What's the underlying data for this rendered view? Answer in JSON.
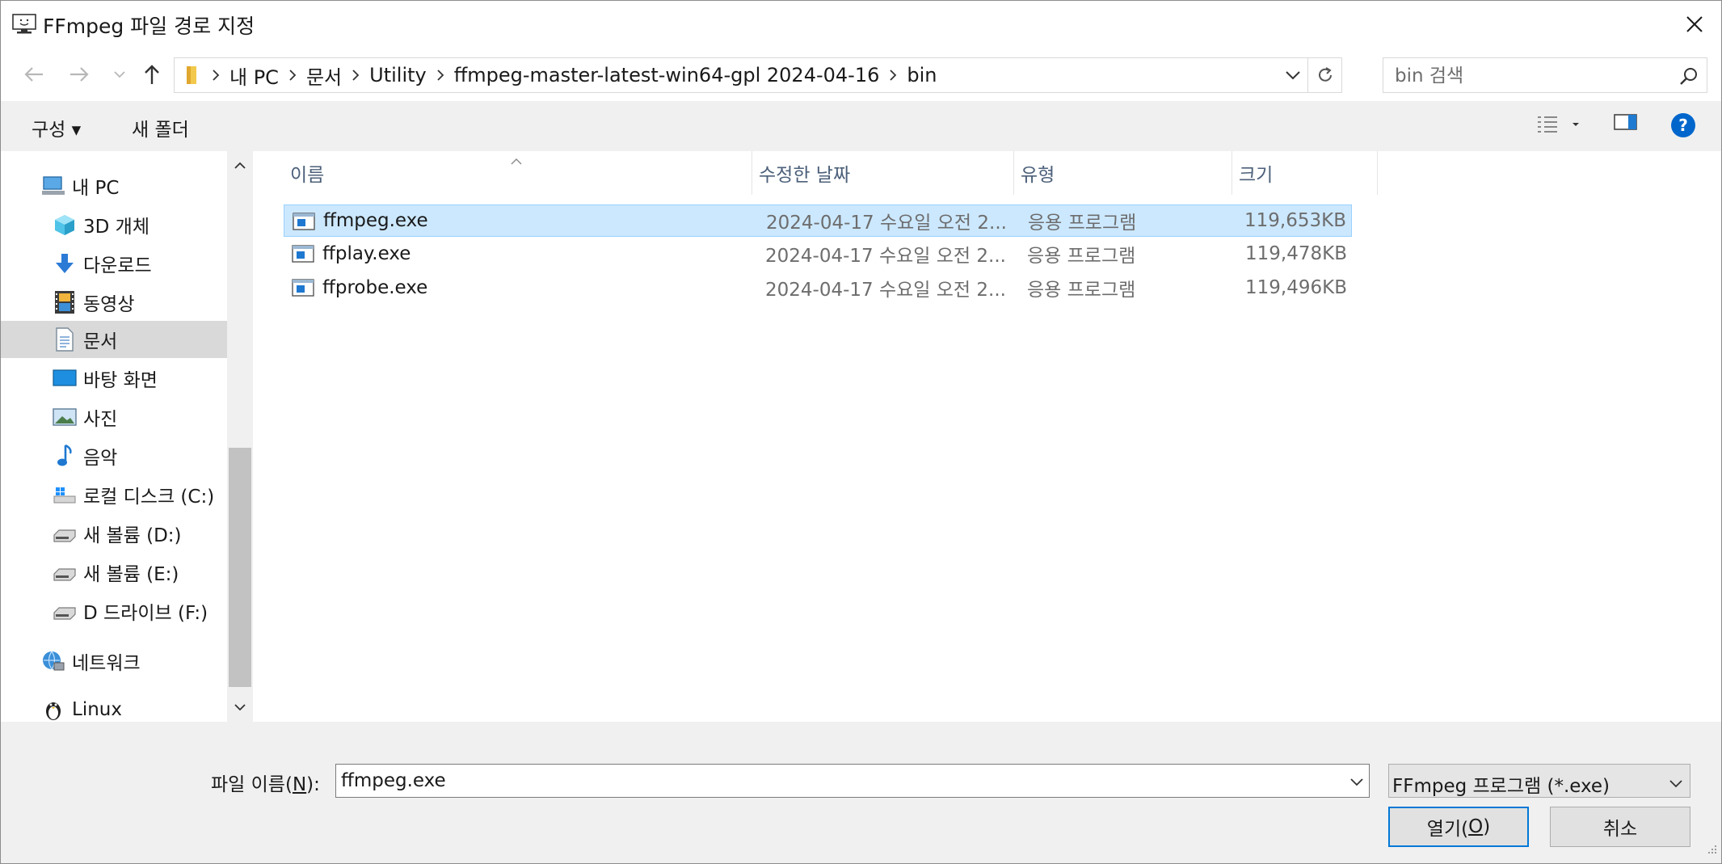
{
  "window": {
    "title": "FFmpeg 파일 경로 지정"
  },
  "address": {
    "crumbs": [
      "내 PC",
      "문서",
      "Utility",
      "ffmpeg-master-latest-win64-gpl 2024-04-16",
      "bin"
    ],
    "search_placeholder": "bin 검색"
  },
  "toolbar": {
    "organize_label": "구성 ▾",
    "new_folder_label": "새 폴더"
  },
  "nav": {
    "items": [
      {
        "label": "내 PC",
        "icon": "computer-icon"
      },
      {
        "label": "3D 개체",
        "icon": "cube-icon"
      },
      {
        "label": "다운로드",
        "icon": "download-arrow-icon"
      },
      {
        "label": "동영상",
        "icon": "film-icon"
      },
      {
        "label": "문서",
        "icon": "document-icon"
      },
      {
        "label": "바탕 화면",
        "icon": "desktop-icon"
      },
      {
        "label": "사진",
        "icon": "picture-icon"
      },
      {
        "label": "음악",
        "icon": "music-note-icon"
      },
      {
        "label": "로컬 디스크 (C:)",
        "icon": "windows-drive-icon"
      },
      {
        "label": "새 볼륨 (D:)",
        "icon": "drive-icon"
      },
      {
        "label": "새 볼륨 (E:)",
        "icon": "drive-icon"
      },
      {
        "label": "D 드라이브 (F:)",
        "icon": "drive-icon"
      },
      {
        "label": "네트워크",
        "icon": "network-icon"
      },
      {
        "label": "Linux",
        "icon": "penguin-icon"
      }
    ],
    "selected_index": 4
  },
  "columns": {
    "name": "이름",
    "modified": "수정한 날짜",
    "type": "유형",
    "size": "크기"
  },
  "files": [
    {
      "name": "ffmpeg.exe",
      "modified": "2024-04-17 수요일 오전 2...",
      "type": "응용 프로그램",
      "size": "119,653KB",
      "selected": true
    },
    {
      "name": "ffplay.exe",
      "modified": "2024-04-17 수요일 오전 2...",
      "type": "응용 프로그램",
      "size": "119,478KB",
      "selected": false
    },
    {
      "name": "ffprobe.exe",
      "modified": "2024-04-17 수요일 오전 2...",
      "type": "응용 프로그램",
      "size": "119,496KB",
      "selected": false
    }
  ],
  "bottom": {
    "filename_label_pre": "파일 이름(",
    "filename_label_key": "N",
    "filename_label_post": "):",
    "filename_value": "ffmpeg.exe",
    "filetype_value": "FFmpeg 프로그램 (*.exe)",
    "open_label_pre": "열기(",
    "open_label_key": "O",
    "open_label_post": ")",
    "cancel_label": "취소"
  },
  "colors": {
    "selection_bg": "#cce8ff",
    "selection_border": "#99d1ff",
    "nav_selected": "#d9d9d9",
    "header_text": "#4c607a",
    "primary_border": "#0078d7",
    "help_blue": "#0066cc"
  }
}
